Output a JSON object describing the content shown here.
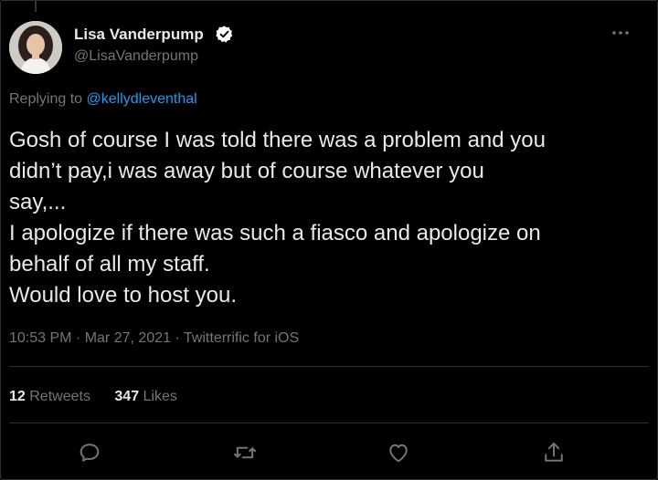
{
  "author": {
    "name": "Lisa Vanderpump",
    "handle": "@LisaVanderpump",
    "verified": true
  },
  "reply": {
    "prefix": "Replying to ",
    "mention": "@kellydleventhal"
  },
  "tweet": {
    "lines": [
      "Gosh of course I was told there was a problem and you",
      "didn’t pay,i was away but of course whatever you",
      "say,...",
      "I apologize if there was such a fiasco and apologize on",
      "behalf of all my staff.",
      "Would love to host you."
    ]
  },
  "meta": {
    "time": "10:53 PM",
    "separator": " · ",
    "date": "Mar 27, 2021",
    "client": "Twitterrific for iOS"
  },
  "stats": {
    "retweets_count": "12",
    "retweets_label": " Retweets",
    "likes_count": "347",
    "likes_label": " Likes"
  },
  "icons": {
    "more": "more-horizontal-icon",
    "verified": "verified-badge-icon",
    "reply": "reply-icon",
    "retweet": "retweet-icon",
    "like": "heart-icon",
    "share": "share-icon"
  },
  "colors": {
    "background": "#000000",
    "text": "#e7e9ea",
    "secondary": "#71767b",
    "accent": "#1d9bf0",
    "divider": "#2f3336"
  }
}
